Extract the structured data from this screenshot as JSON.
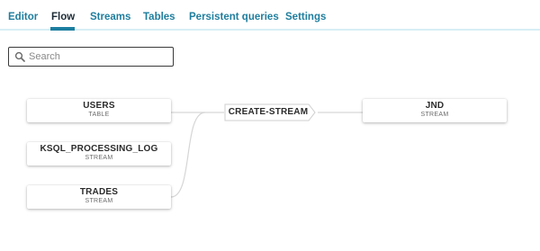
{
  "tabs": [
    {
      "label": "Editor",
      "active": false
    },
    {
      "label": "Flow",
      "active": true
    },
    {
      "label": "Streams",
      "active": false
    },
    {
      "label": "Tables",
      "active": false
    },
    {
      "label": "Persistent queries",
      "active": false
    },
    {
      "label": "Settings",
      "active": false
    }
  ],
  "search": {
    "placeholder": "Search",
    "value": ""
  },
  "flow": {
    "sources": [
      {
        "name": "USERS",
        "type": "TABLE"
      },
      {
        "name": "KSQL_PROCESSING_LOG",
        "type": "STREAM"
      },
      {
        "name": "TRADES",
        "type": "STREAM"
      }
    ],
    "query": {
      "label": "CREATE-STREAM"
    },
    "sink": {
      "name": "JND",
      "type": "STREAM"
    }
  },
  "colors": {
    "tab_text": "#1f7e9e",
    "tab_active_text": "#1d2b36",
    "tab_underline": "#1c7ea0",
    "tab_bar_border": "#d7eef5",
    "edge": "#d6d6d6"
  }
}
